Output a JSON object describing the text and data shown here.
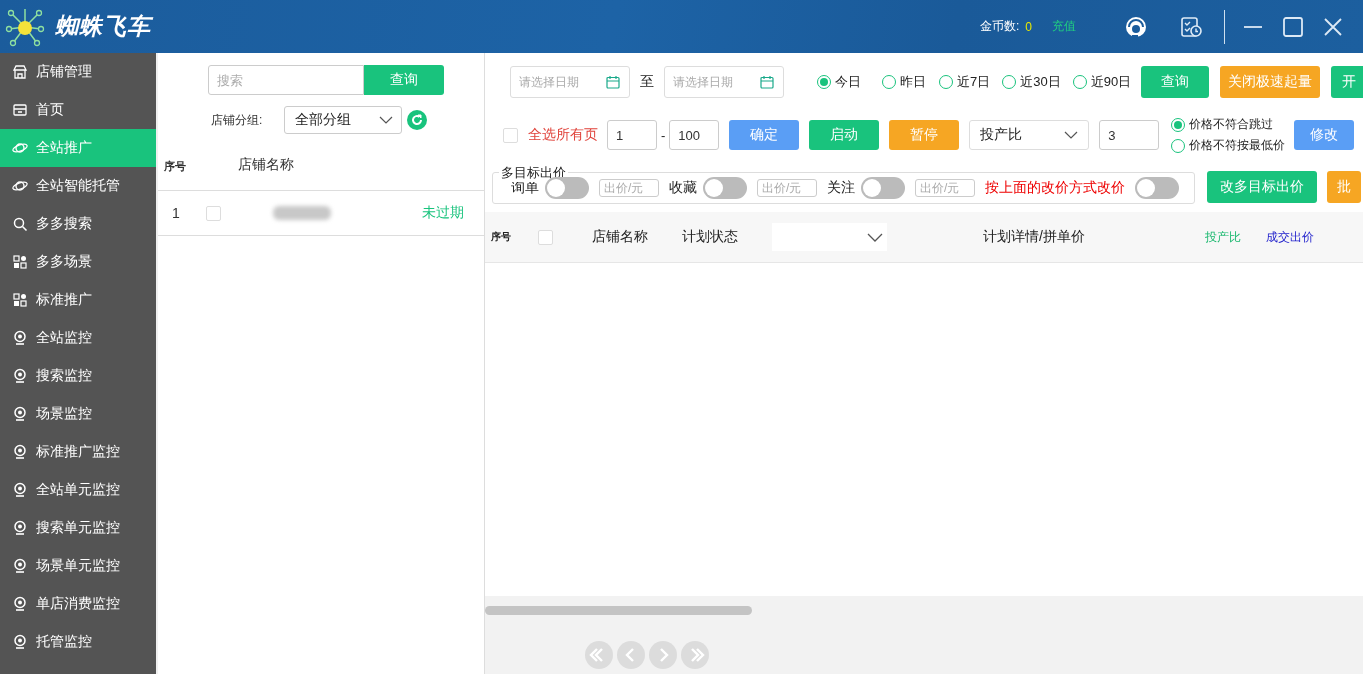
{
  "header": {
    "title": "蜘蛛飞车",
    "coins_label": "金币数:",
    "coins": "0",
    "recharge": "充值"
  },
  "sidebar": {
    "items": [
      {
        "label": "店铺管理",
        "kind": "store",
        "selected": false
      },
      {
        "label": "首页",
        "kind": "home",
        "selected": false
      },
      {
        "label": "全站推广",
        "kind": "promotion",
        "selected": true
      },
      {
        "label": "全站智能托管",
        "kind": "promotion",
        "selected": false
      },
      {
        "label": "多多搜索",
        "kind": "search",
        "selected": false
      },
      {
        "label": "多多场景",
        "kind": "scene",
        "selected": false
      },
      {
        "label": "标准推广",
        "kind": "scene",
        "selected": false
      },
      {
        "label": "全站监控",
        "kind": "monitor",
        "selected": false
      },
      {
        "label": "搜索监控",
        "kind": "monitor",
        "selected": false
      },
      {
        "label": "场景监控",
        "kind": "monitor",
        "selected": false
      },
      {
        "label": "标准推广监控",
        "kind": "monitor",
        "selected": false
      },
      {
        "label": "全站单元监控",
        "kind": "monitor",
        "selected": false
      },
      {
        "label": "搜索单元监控",
        "kind": "monitor",
        "selected": false
      },
      {
        "label": "场景单元监控",
        "kind": "monitor",
        "selected": false
      },
      {
        "label": "单店消费监控",
        "kind": "monitor",
        "selected": false
      },
      {
        "label": "托管监控",
        "kind": "monitor",
        "selected": false
      }
    ]
  },
  "shop_panel": {
    "search": {
      "placeholder": "搜索",
      "button": "查询"
    },
    "group": {
      "label": "店铺分组:",
      "value": "全部分组"
    },
    "columns": [
      "序号",
      "店铺名称"
    ],
    "rows": [
      {
        "index": "1",
        "checked": false,
        "status": "未过期"
      }
    ]
  },
  "plans": {
    "date_from": {
      "placeholder": "请选择日期"
    },
    "to": "至",
    "date_to": {
      "placeholder": "请选择日期"
    },
    "ranges": [
      {
        "label": "今日",
        "selected": true
      },
      {
        "label": "昨日",
        "selected": false
      },
      {
        "label": "近7日",
        "selected": false
      },
      {
        "label": "近30日",
        "selected": false
      },
      {
        "label": "近90日",
        "selected": false
      }
    ],
    "top_buttons": [
      {
        "label": "查询",
        "color": "#19c37d"
      },
      {
        "label": "关闭极速起量",
        "color": "#f6a623"
      },
      {
        "label": "开",
        "color": "#19c37d"
      }
    ],
    "select_all": {
      "label": "全选所有页",
      "checked": false
    },
    "range_from": "1",
    "range_sep": "-",
    "range_to": "100",
    "action_buttons": [
      {
        "label": "确定",
        "color": "#5a9ef5"
      },
      {
        "label": "启动",
        "color": "#19c37d"
      },
      {
        "label": "暂停",
        "color": "#f6a623"
      }
    ],
    "metric": {
      "value": "投产比"
    },
    "metric_value": "3",
    "price_rules": [
      {
        "label": "价格不符合跳过",
        "selected": true
      },
      {
        "label": "价格不符按最低价",
        "selected": false
      }
    ],
    "modify_button": {
      "label": "修改",
      "color": "#5a9ef5"
    },
    "multi_target": {
      "legend": "多目标出价",
      "targets": [
        {
          "label": "询单",
          "on": false,
          "placeholder": "出价/元"
        },
        {
          "label": "收藏",
          "on": false,
          "placeholder": "出价/元"
        },
        {
          "label": "关注",
          "on": false,
          "placeholder": "出价/元"
        }
      ],
      "note": "按上面的改价方式改价",
      "note_on": false
    },
    "target_buttons": [
      {
        "label": "改多目标出价",
        "color": "#19c37d"
      },
      {
        "label": "批",
        "color": "#f6a623"
      }
    ],
    "columns": [
      {
        "label": "序号",
        "kind": "index"
      },
      {
        "kind": "checkbox",
        "checked": false
      },
      {
        "label": "店铺名称",
        "kind": "text"
      },
      {
        "label": "计划状态",
        "kind": "text"
      },
      {
        "kind": "dropdown"
      },
      {
        "label": "计划详情/拼单价",
        "kind": "text"
      },
      {
        "label": "投产比",
        "kind": "metric"
      },
      {
        "label": "成交出价",
        "kind": "price"
      }
    ]
  }
}
